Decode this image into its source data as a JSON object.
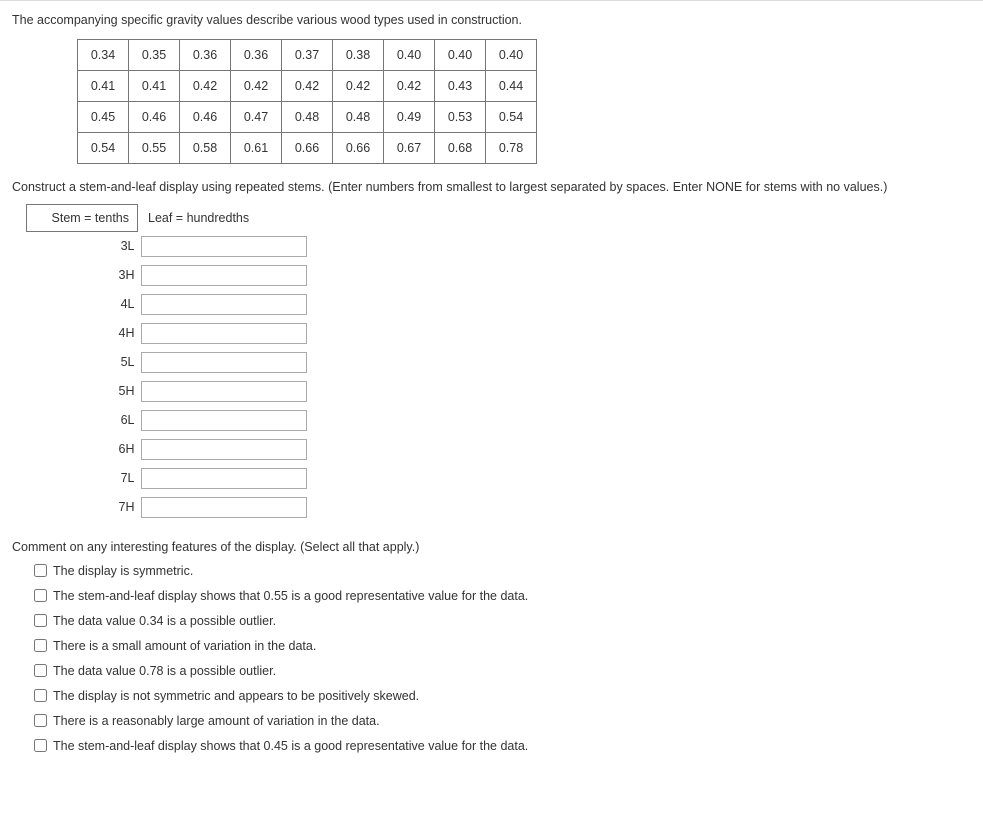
{
  "intro": "The accompanying specific gravity values describe various wood types used in construction.",
  "data_rows": [
    [
      "0.34",
      "0.35",
      "0.36",
      "0.36",
      "0.37",
      "0.38",
      "0.40",
      "0.40",
      "0.40"
    ],
    [
      "0.41",
      "0.41",
      "0.42",
      "0.42",
      "0.42",
      "0.42",
      "0.42",
      "0.43",
      "0.44"
    ],
    [
      "0.45",
      "0.46",
      "0.46",
      "0.47",
      "0.48",
      "0.48",
      "0.49",
      "0.53",
      "0.54"
    ],
    [
      "0.54",
      "0.55",
      "0.58",
      "0.61",
      "0.66",
      "0.66",
      "0.67",
      "0.68",
      "0.78"
    ]
  ],
  "instruction": "Construct a stem-and-leaf display using repeated stems. (Enter numbers from smallest to largest separated by spaces. Enter NONE for stems with no values.)",
  "stem_header": "Stem = tenths",
  "leaf_header": "Leaf = hundredths",
  "stems": [
    "3L",
    "3H",
    "4L",
    "4H",
    "5L",
    "5H",
    "6L",
    "6H",
    "7L",
    "7H"
  ],
  "comment_prompt": "Comment on any interesting features of the display. (Select all that apply.)",
  "options": [
    "The display is symmetric.",
    "The stem-and-leaf display shows that 0.55 is a good representative value for the data.",
    "The data value 0.34 is a possible outlier.",
    "There is a small amount of variation in the data.",
    "The data value 0.78 is a possible outlier.",
    "The display is not symmetric and appears to be positively skewed.",
    "There is a reasonably large amount of variation in the data.",
    "The stem-and-leaf display shows that 0.45 is a good representative value for the data."
  ]
}
